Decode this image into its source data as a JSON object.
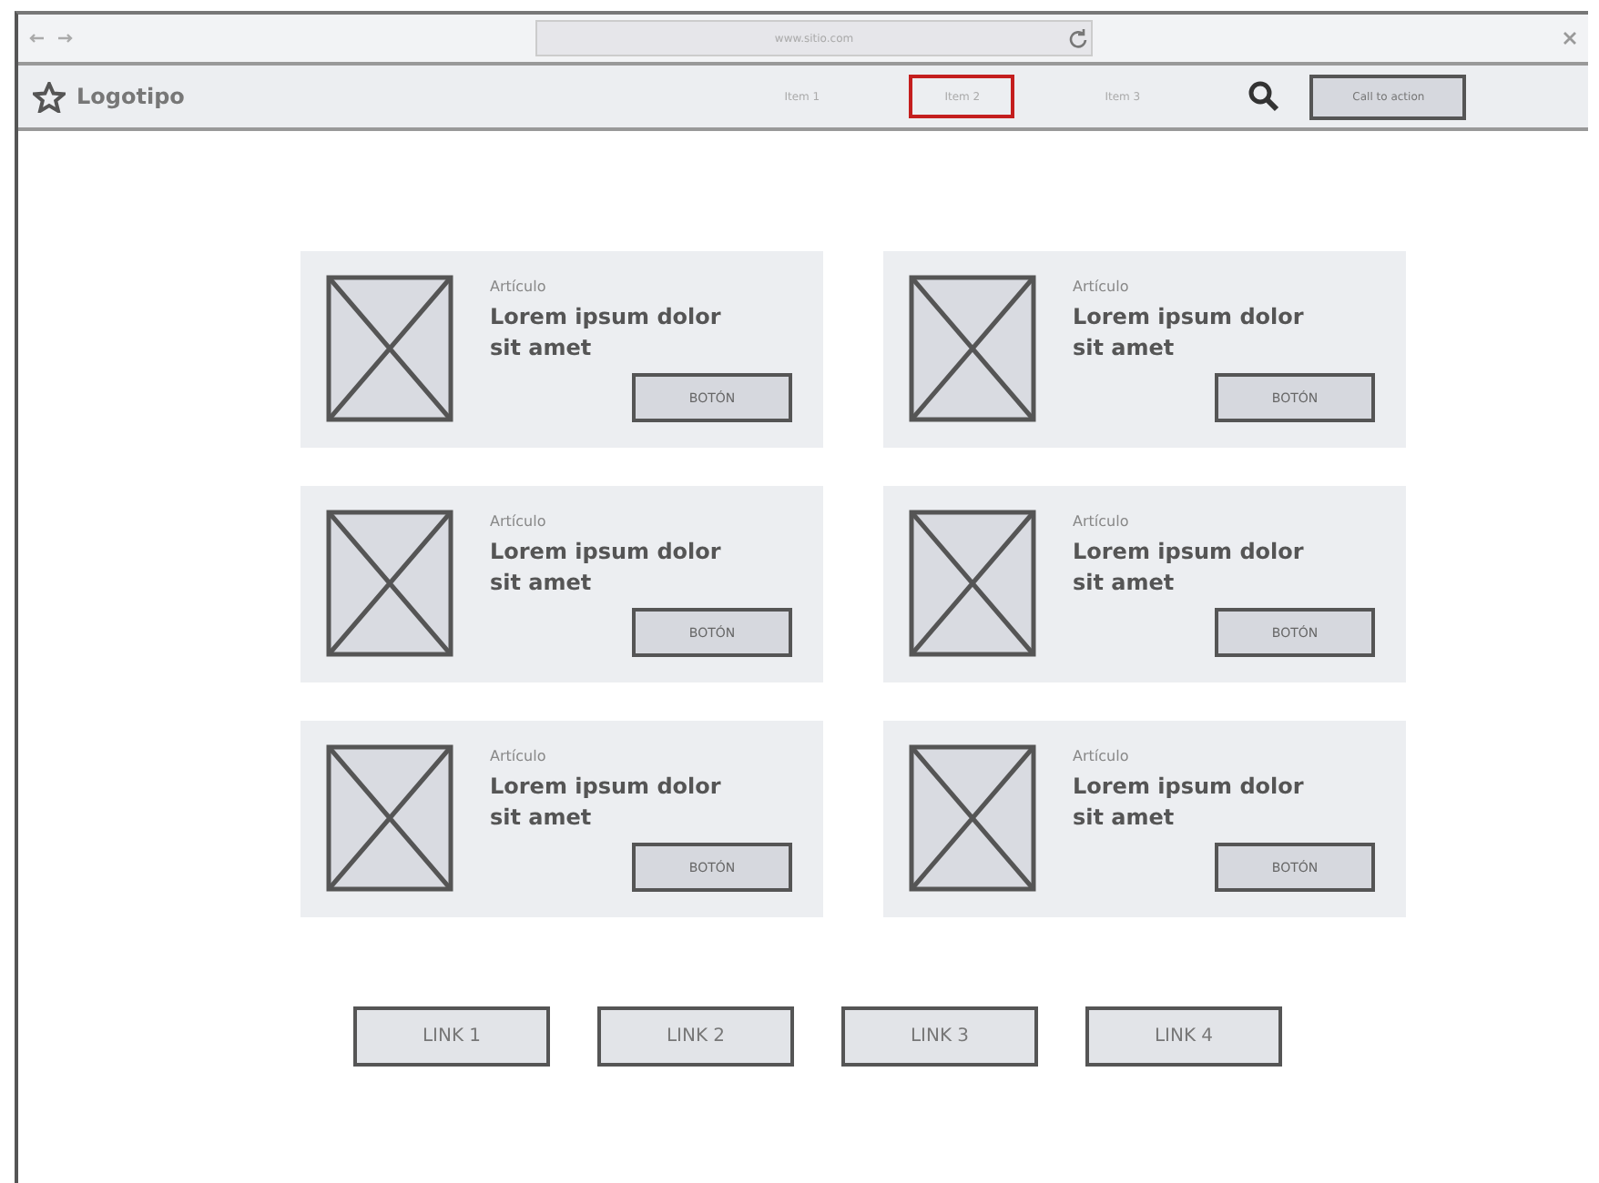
{
  "browser": {
    "address": "www.sitio.com"
  },
  "navbar": {
    "logo": "Logotipo",
    "items": [
      {
        "label": "Item 1",
        "selected": false
      },
      {
        "label": "Item 2",
        "selected": true
      },
      {
        "label": "Item 3",
        "selected": false
      }
    ],
    "action_button": "Call to action"
  },
  "cards": [
    {
      "label": "Artículo",
      "title": "Lorem ipsum dolor sit amet",
      "button": "BOTÓN"
    },
    {
      "label": "Artículo",
      "title": "Lorem ipsum dolor sit amet",
      "button": "BOTÓN"
    },
    {
      "label": "Artículo",
      "title": "Lorem ipsum dolor sit amet",
      "button": "BOTÓN"
    },
    {
      "label": "Artículo",
      "title": "Lorem ipsum dolor sit amet",
      "button": "BOTÓN"
    },
    {
      "label": "Artículo",
      "title": "Lorem ipsum dolor sit amet",
      "button": "BOTÓN"
    },
    {
      "label": "Artículo",
      "title": "Lorem ipsum dolor sit amet",
      "button": "BOTÓN"
    }
  ],
  "links": [
    "LINK 1",
    "LINK 2",
    "LINK 3",
    "LINK 4"
  ]
}
